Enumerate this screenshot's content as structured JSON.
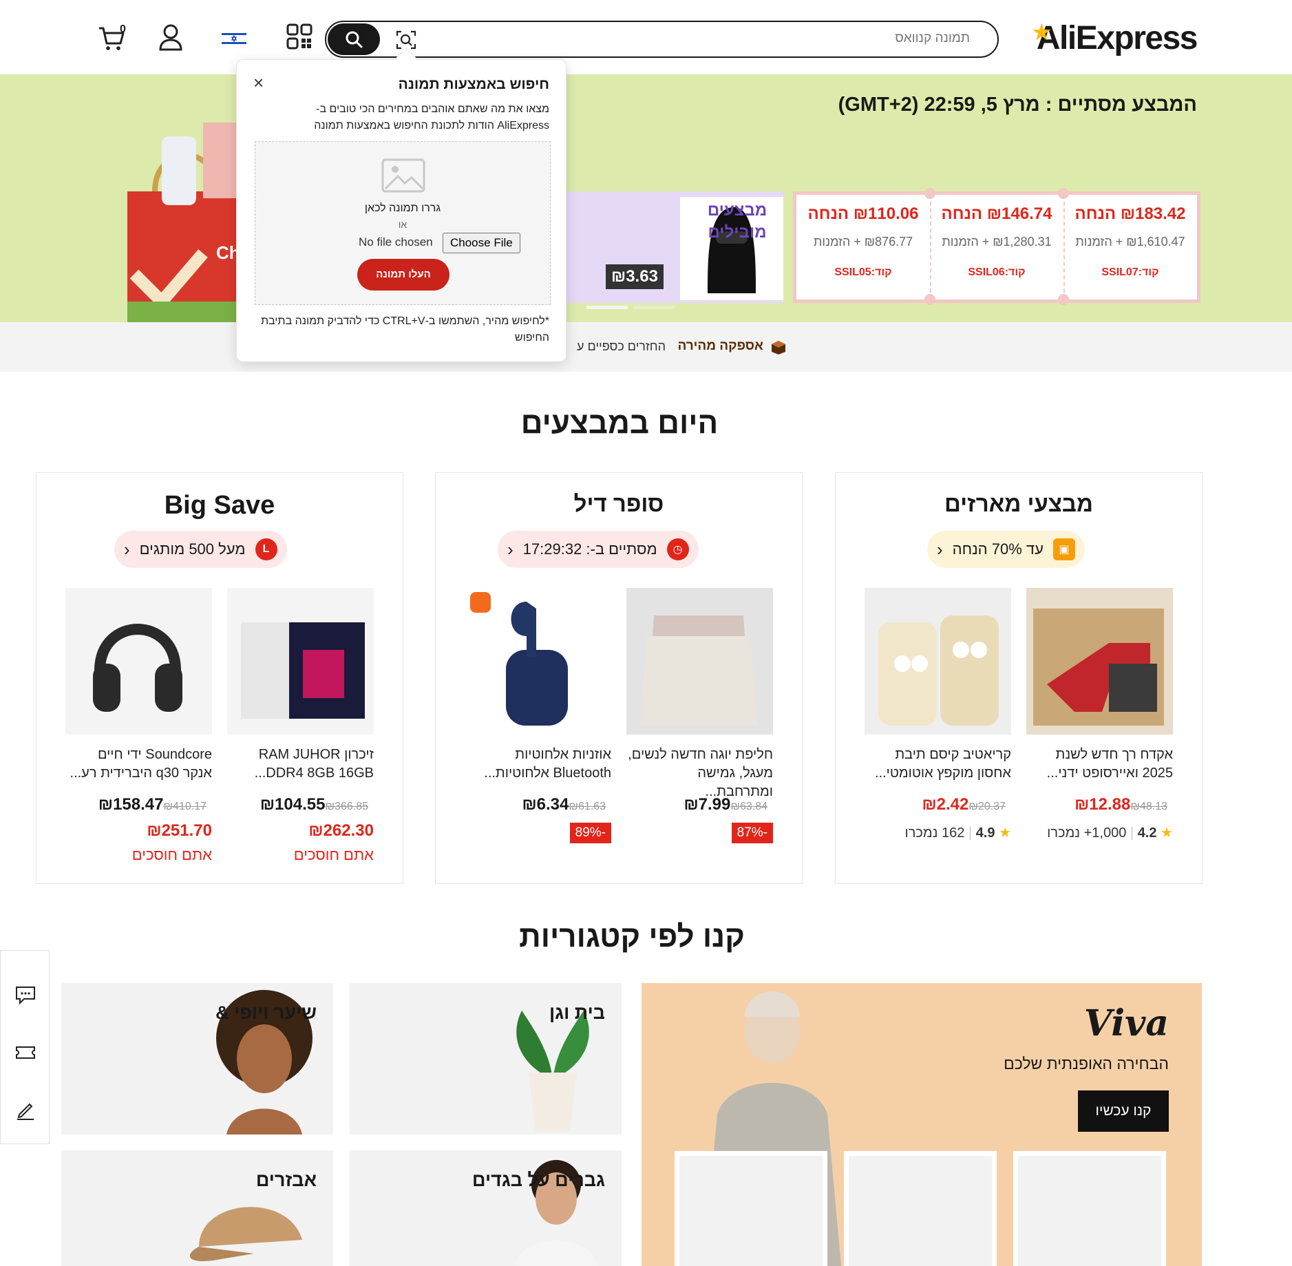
{
  "header": {
    "logo": "AliExpress",
    "search_placeholder": "תמונה קנוואס",
    "cart_count": "0",
    "icons": [
      "camera-search-icon",
      "search-icon",
      "qr-code-icon",
      "israel-flag-icon",
      "user-icon",
      "cart-icon"
    ]
  },
  "banner": {
    "countdown": "המבצע מסתיים : מרץ 5, 22:59 (GMT+2)",
    "coupons": [
      {
        "off": "₪183.42 הנחה",
        "min": "₪1,610.47 + הזמנות",
        "code": "קוד:SSIL07"
      },
      {
        "off": "₪146.74 הנחה",
        "min": "₪1,280.31 + הזמנות",
        "code": "קוד:SSIL06"
      },
      {
        "off": "₪110.06 הנחה",
        "min": "₪876.77 + הזמנות",
        "code": "קוד:SSIL05"
      }
    ],
    "mobile_deals": {
      "label": "מבצעים מובילים",
      "price": "₪3.63"
    },
    "left_promo_text": "Ch"
  },
  "strip": {
    "fast_shipping": "אספקה מהירה",
    "refunds": "החזרים כספיים ע"
  },
  "popup": {
    "title": "חיפוש באמצעות תמונה",
    "description": "מצאו את מה שאתם אוהבים במחירים הכי טובים ב-AliExpress הודות לתכונת החיפוש באמצעות תמונה",
    "drag_text": "גררו תמונה לכאן",
    "or_text": "או",
    "no_file": "No file chosen",
    "choose_file": "Choose File",
    "upload": "העלו תמונה",
    "tip": "*לחיפוש מהיר, השתמשו ב-CTRL+V כדי להדביק תמונה בתיבת החיפוש",
    "close": "×"
  },
  "deals": {
    "title": "היום במבצעים",
    "cards": [
      {
        "title": "מבצעי מארזים",
        "pill": "עד 70% הנחה",
        "products": [
          {
            "name": "אקדח רך חדש לשנת 2025 ואיירסופט ידני...",
            "price": "₪12.88",
            "orig": "₪48.13",
            "rating": "4.2",
            "sold": "1,000+ נמכרו"
          },
          {
            "name": "קריאטיב קיסם תיבת אחסון מוקפץ אוטומטי...",
            "price": "₪2.42",
            "orig": "₪20.37",
            "rating": "4.9",
            "sold": "162 נמכרו"
          }
        ]
      },
      {
        "title": "סופר דיל",
        "pill": "מסתיים ב-: 17:29:32",
        "products": [
          {
            "name": "חליפת יוגה חדשה לנשים, מעגל, גמישה ומתרחבת...",
            "price": "₪7.99",
            "orig": "₪63.84",
            "discount": "-87%"
          },
          {
            "name": "אוזניות אלחוטיות Bluetooth אלחוטיות...",
            "price": "₪6.34",
            "orig": "₪61.63",
            "discount": "-89%"
          }
        ]
      },
      {
        "title": "Big Save",
        "pill": "מעל 500 מותגים",
        "products": [
          {
            "name": "זיכרון RAM JUHOR DDR4 8GB 16GB...",
            "price": "₪104.55",
            "orig": "₪366.85",
            "save": "₪262.30",
            "save_label": "אתם חוסכים"
          },
          {
            "name": "Soundcore ידי חיים אנקר q30 היברידית רע...",
            "price": "₪158.47",
            "orig": "₪410.17",
            "save": "₪251.70",
            "save_label": "אתם חוסכים"
          }
        ]
      }
    ]
  },
  "categories": {
    "title": "קנו לפי קטגוריות",
    "viva": {
      "logo": "Viva",
      "subtitle": "הבחירה האופנתית שלכם",
      "button": "קנו עכשיו"
    },
    "tiles": [
      "בית וגן",
      "שיער ויופי &",
      "גברים על בגדים",
      "אבזרים"
    ]
  },
  "colors": {
    "accent": "#e1251b",
    "banner_bg": "#dcebab",
    "viva_bg": "#f5d0a7",
    "purple": "#e6d9f7"
  }
}
